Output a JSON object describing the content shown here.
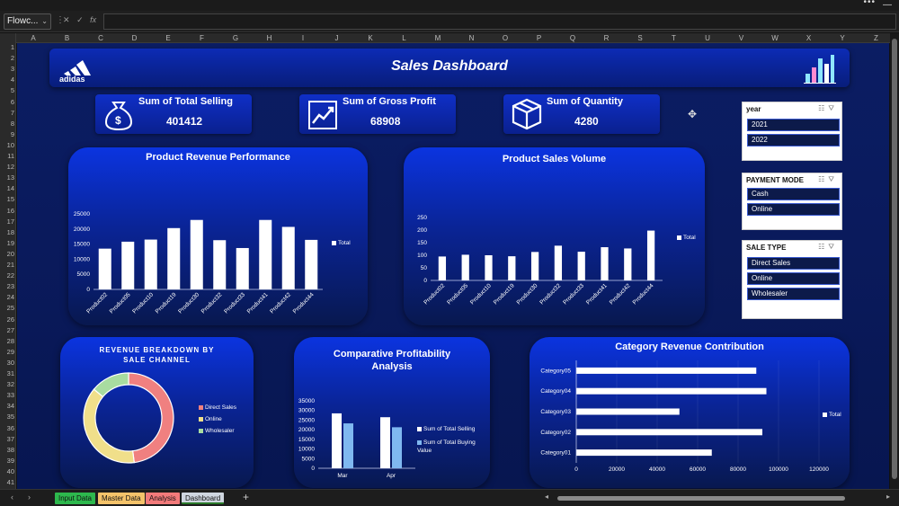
{
  "excel": {
    "name_box": "Flowc...",
    "formula_buttons": [
      "✕",
      "✓",
      "fx"
    ],
    "columns": [
      "A",
      "B",
      "C",
      "D",
      "E",
      "F",
      "G",
      "H",
      "I",
      "J",
      "K",
      "L",
      "M",
      "N",
      "O",
      "P",
      "Q",
      "R",
      "S",
      "T",
      "U",
      "V",
      "W",
      "X",
      "Y",
      "Z"
    ],
    "rows": [
      "1",
      "2",
      "3",
      "4",
      "5",
      "6",
      "7",
      "8",
      "9",
      "10",
      "11",
      "12",
      "13",
      "14",
      "15",
      "16",
      "17",
      "18",
      "19",
      "20",
      "21",
      "22",
      "23",
      "24",
      "25",
      "26",
      "27",
      "28",
      "29",
      "30",
      "31",
      "32",
      "33",
      "34",
      "35",
      "36",
      "37",
      "38",
      "39",
      "40",
      "41"
    ],
    "sheet_tabs": [
      {
        "label": "Input Data",
        "color": "#2db84d"
      },
      {
        "label": "Master Data",
        "color": "#f4c36a"
      },
      {
        "label": "Analysis",
        "color": "#f27a7a"
      },
      {
        "label": "Dashboard",
        "color": "#cfd6e0"
      }
    ],
    "add_sheet": "+"
  },
  "header": {
    "title": "Sales Dashboard",
    "brand": "adidas"
  },
  "kpis": [
    {
      "label": "Sum of Total Selling",
      "value": "401412",
      "icon": "money-bag-icon"
    },
    {
      "label": "Sum of Gross Profit",
      "value": "68908",
      "icon": "trend-chart-icon"
    },
    {
      "label": "Sum of Quantity",
      "value": "4280",
      "icon": "box-icon"
    }
  ],
  "slicers": {
    "year": {
      "title": "year",
      "items": [
        "2021",
        "2022"
      ]
    },
    "payment": {
      "title": "PAYMENT MODE",
      "items": [
        "Cash",
        "Online"
      ]
    },
    "sale_type": {
      "title": "SALE TYPE",
      "items": [
        "Direct Sales",
        "Online",
        "Wholesaler"
      ]
    }
  },
  "colors": {
    "bar_white": "#ffffff",
    "bar_light_blue": "#7fb8f0",
    "pie_red": "#f08080",
    "pie_yellow": "#f0df8a",
    "pie_green": "#a8dca0"
  },
  "chart_data": [
    {
      "id": "revenue",
      "type": "bar",
      "title": "Product Revenue Performance",
      "categories": [
        "Product02",
        "Product05",
        "Product10",
        "Product19",
        "Product30",
        "Product32",
        "Product33",
        "Product41",
        "Product42",
        "Product44"
      ],
      "series": [
        {
          "name": "Total",
          "values": [
            13500,
            15800,
            16500,
            20300,
            23000,
            16300,
            13700,
            23000,
            20700,
            16400
          ]
        }
      ],
      "ylim": [
        0,
        25000
      ],
      "yticks": [
        0,
        5000,
        10000,
        15000,
        20000,
        25000
      ],
      "legend": "right"
    },
    {
      "id": "volume",
      "type": "bar",
      "title": "Product Sales Volume",
      "categories": [
        "Product02",
        "Product05",
        "Product10",
        "Product19",
        "Product30",
        "Product32",
        "Product33",
        "Product41",
        "Product42",
        "Product44"
      ],
      "series": [
        {
          "name": "Total",
          "values": [
            95,
            102,
            100,
            96,
            113,
            138,
            114,
            132,
            127,
            198
          ]
        }
      ],
      "ylim": [
        0,
        250
      ],
      "yticks": [
        0,
        50,
        100,
        150,
        200,
        250
      ],
      "legend": "right"
    },
    {
      "id": "channel",
      "type": "pie",
      "title": "REVENUE BREAKDOWN BY SALE CHANNEL",
      "categories": [
        "Direct Sales",
        "Online",
        "Wholesaler"
      ],
      "values": [
        48,
        38,
        14
      ],
      "legend": "right"
    },
    {
      "id": "profitability",
      "type": "bar",
      "title": "Comparative Profitability Analysis",
      "categories": [
        "Mar",
        "Apr"
      ],
      "series": [
        {
          "name": "Sum of Total Selling",
          "values": [
            28500,
            26500
          ]
        },
        {
          "name": "Sum of Total Buying Value",
          "values": [
            23300,
            21300
          ]
        }
      ],
      "ylim": [
        0,
        35000
      ],
      "yticks": [
        0,
        5000,
        10000,
        15000,
        20000,
        25000,
        30000,
        35000
      ],
      "legend": "right"
    },
    {
      "id": "category",
      "type": "bar",
      "title": "Category Revenue Contribution",
      "categories": [
        "Category05",
        "Category04",
        "Category03",
        "Category02",
        "Category01"
      ],
      "series": [
        {
          "name": "Total",
          "values": [
            89000,
            94000,
            51000,
            92000,
            67000
          ]
        }
      ],
      "xlim": [
        0,
        120000
      ],
      "xticks": [
        0,
        20000,
        40000,
        60000,
        80000,
        100000,
        120000
      ],
      "orientation": "horizontal",
      "legend": "right"
    }
  ]
}
